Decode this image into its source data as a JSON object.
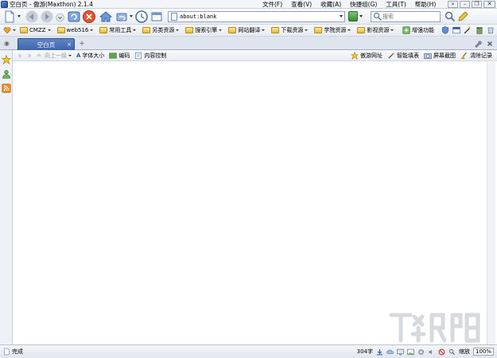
{
  "window": {
    "title": "空白页 - 傲游(Maxthon) 2.1.4"
  },
  "menu": [
    {
      "label": "文件(F)"
    },
    {
      "label": "查看(V)"
    },
    {
      "label": "收藏(A)"
    },
    {
      "label": "快捷组(G)"
    },
    {
      "label": "工具(T)"
    },
    {
      "label": "帮助(H)"
    }
  ],
  "window_controls": {
    "extra": "»",
    "minimize": "–",
    "restore": "❐",
    "close": "✕"
  },
  "address": {
    "value": "about:blank"
  },
  "search": {
    "placeholder": "搜索"
  },
  "favorites": [
    {
      "label": "CMZZ"
    },
    {
      "label": "web516"
    },
    {
      "label": "常用工具"
    },
    {
      "label": "另类资源"
    },
    {
      "label": "搜索引擎"
    },
    {
      "label": "网站翻译"
    },
    {
      "label": "下载资源"
    },
    {
      "label": "学院资源"
    },
    {
      "label": "影视资源"
    }
  ],
  "favorites_right": {
    "enhance": "增强功能"
  },
  "tab": {
    "label": "空白页",
    "close": "×"
  },
  "subbar": {
    "up": "向上一级",
    "font": "字体大小",
    "encoding": "编码",
    "content_control": "内容控制",
    "site_nav": "傲游网址",
    "smart_fill": "智能填表",
    "screenshot": "屏幕截图",
    "clear": "清除记录"
  },
  "status": {
    "text": "完成",
    "size": "304字",
    "zoom_label": "缩放",
    "zoom_value": "100%"
  },
  "colors": {
    "accent": "#3e65a9",
    "tab_active": "#5d84c4"
  },
  "icons": [
    "new-page-icon",
    "back-icon",
    "forward-icon",
    "refresh-icon",
    "stop-icon",
    "home-icon",
    "undo-icon",
    "history-icon",
    "window-icon",
    "search-icon",
    "star-icon",
    "user-icon",
    "rss-icon",
    "folder-icon"
  ]
}
